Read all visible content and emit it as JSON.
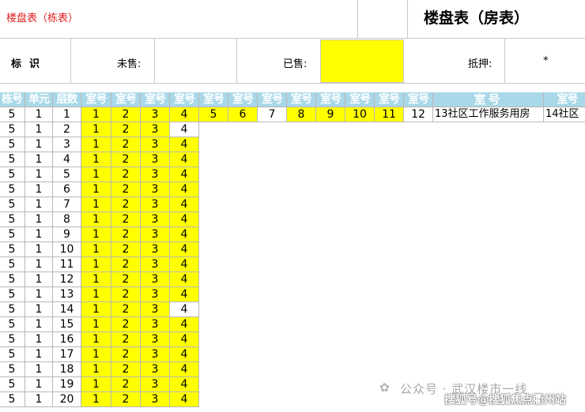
{
  "top": {
    "left_title": "楼盘表（栋表）",
    "right_title": "楼盘表（房表）"
  },
  "legend": {
    "label": "标识",
    "unsold_label": "未售:",
    "sold_label": "已售:",
    "mortgage_label": "抵押:",
    "mortgage_value": "*",
    "colors": {
      "sold": "#ffff00",
      "unsold": "#ffffff",
      "header": "#a9d8e8"
    }
  },
  "table": {
    "headers": [
      "栋号",
      "单元",
      "层数",
      "室号",
      "室号",
      "室号",
      "室号",
      "室号",
      "室号",
      "室号",
      "室号",
      "室号",
      "室号",
      "室号",
      "室号",
      "室号",
      "室号"
    ],
    "first_row": {
      "building": "5",
      "unit": "1",
      "floor": "1",
      "rooms": [
        "1",
        "2",
        "3",
        "4",
        "5",
        "6",
        "7",
        "8",
        "9",
        "10",
        "11",
        "12",
        "13社区工作服务用房",
        "14社区"
      ],
      "room_status": [
        "sold",
        "sold",
        "sold",
        "sold",
        "sold",
        "sold",
        "unsold",
        "sold",
        "sold",
        "sold",
        "sold",
        "unsold",
        "unsold",
        "unsold"
      ]
    },
    "rows": [
      {
        "building": "5",
        "unit": "1",
        "floor": "2",
        "rooms": [
          "1",
          "2",
          "3",
          "4"
        ],
        "status": [
          "sold",
          "sold",
          "sold",
          "unsold"
        ]
      },
      {
        "building": "5",
        "unit": "1",
        "floor": "3",
        "rooms": [
          "1",
          "2",
          "3",
          "4"
        ],
        "status": [
          "sold",
          "sold",
          "sold",
          "sold"
        ]
      },
      {
        "building": "5",
        "unit": "1",
        "floor": "4",
        "rooms": [
          "1",
          "2",
          "3",
          "4"
        ],
        "status": [
          "sold",
          "sold",
          "sold",
          "sold"
        ]
      },
      {
        "building": "5",
        "unit": "1",
        "floor": "5",
        "rooms": [
          "1",
          "2",
          "3",
          "4"
        ],
        "status": [
          "sold",
          "sold",
          "sold",
          "sold"
        ]
      },
      {
        "building": "5",
        "unit": "1",
        "floor": "6",
        "rooms": [
          "1",
          "2",
          "3",
          "4"
        ],
        "status": [
          "sold",
          "sold",
          "sold",
          "sold"
        ]
      },
      {
        "building": "5",
        "unit": "1",
        "floor": "7",
        "rooms": [
          "1",
          "2",
          "3",
          "4"
        ],
        "status": [
          "sold",
          "sold",
          "sold",
          "sold"
        ]
      },
      {
        "building": "5",
        "unit": "1",
        "floor": "8",
        "rooms": [
          "1",
          "2",
          "3",
          "4"
        ],
        "status": [
          "sold",
          "sold",
          "sold",
          "sold"
        ]
      },
      {
        "building": "5",
        "unit": "1",
        "floor": "9",
        "rooms": [
          "1",
          "2",
          "3",
          "4"
        ],
        "status": [
          "sold",
          "sold",
          "sold",
          "sold"
        ]
      },
      {
        "building": "5",
        "unit": "1",
        "floor": "10",
        "rooms": [
          "1",
          "2",
          "3",
          "4"
        ],
        "status": [
          "sold",
          "sold",
          "sold",
          "sold"
        ]
      },
      {
        "building": "5",
        "unit": "1",
        "floor": "11",
        "rooms": [
          "1",
          "2",
          "3",
          "4"
        ],
        "status": [
          "sold",
          "sold",
          "sold",
          "sold"
        ]
      },
      {
        "building": "5",
        "unit": "1",
        "floor": "12",
        "rooms": [
          "1",
          "2",
          "3",
          "4"
        ],
        "status": [
          "sold",
          "sold",
          "sold",
          "sold"
        ]
      },
      {
        "building": "5",
        "unit": "1",
        "floor": "13",
        "rooms": [
          "1",
          "2",
          "3",
          "4"
        ],
        "status": [
          "sold",
          "sold",
          "sold",
          "sold"
        ]
      },
      {
        "building": "5",
        "unit": "1",
        "floor": "14",
        "rooms": [
          "1",
          "2",
          "3",
          "4"
        ],
        "status": [
          "sold",
          "sold",
          "sold",
          "unsold"
        ]
      },
      {
        "building": "5",
        "unit": "1",
        "floor": "15",
        "rooms": [
          "1",
          "2",
          "3",
          "4"
        ],
        "status": [
          "sold",
          "sold",
          "sold",
          "sold"
        ]
      },
      {
        "building": "5",
        "unit": "1",
        "floor": "16",
        "rooms": [
          "1",
          "2",
          "3",
          "4"
        ],
        "status": [
          "sold",
          "sold",
          "sold",
          "sold"
        ]
      },
      {
        "building": "5",
        "unit": "1",
        "floor": "17",
        "rooms": [
          "1",
          "2",
          "3",
          "4"
        ],
        "status": [
          "sold",
          "sold",
          "sold",
          "sold"
        ]
      },
      {
        "building": "5",
        "unit": "1",
        "floor": "18",
        "rooms": [
          "1",
          "2",
          "3",
          "4"
        ],
        "status": [
          "sold",
          "sold",
          "sold",
          "sold"
        ]
      },
      {
        "building": "5",
        "unit": "1",
        "floor": "19",
        "rooms": [
          "1",
          "2",
          "3",
          "4"
        ],
        "status": [
          "sold",
          "sold",
          "sold",
          "sold"
        ]
      },
      {
        "building": "5",
        "unit": "1",
        "floor": "20",
        "rooms": [
          "1",
          "2",
          "3",
          "4"
        ],
        "status": [
          "sold",
          "sold",
          "sold",
          "sold"
        ]
      }
    ]
  },
  "watermark": {
    "line1": "公众号 · 武汉楼市一线",
    "line2": "搜狐号@搜狐焦点衢州站",
    "logo_icon": "wechat-icon"
  }
}
